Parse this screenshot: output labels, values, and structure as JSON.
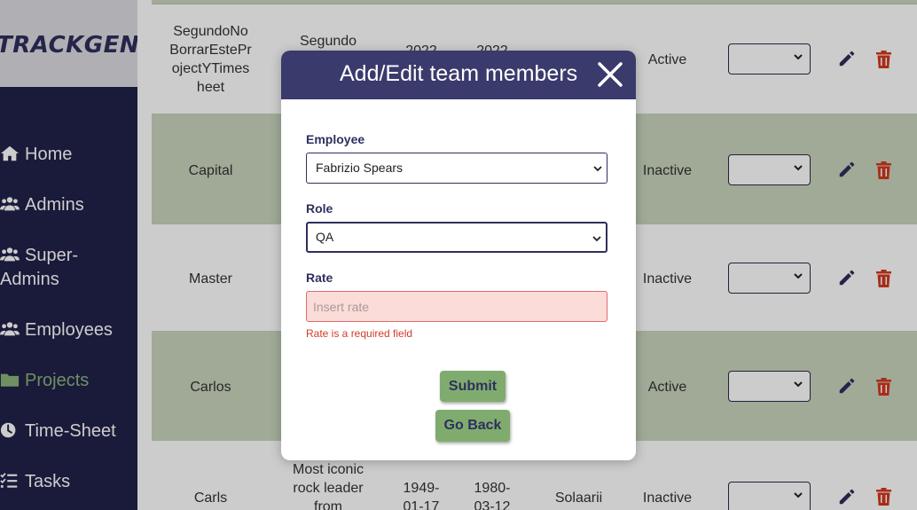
{
  "app": {
    "logo": "TRACKGENIX"
  },
  "sidebar": {
    "items": [
      {
        "label": "Home",
        "icon": "home-icon"
      },
      {
        "label": "Admins",
        "icon": "users-icon"
      },
      {
        "label": "Super-",
        "label2": "Admins",
        "icon": "users-icon"
      },
      {
        "label": "Employees",
        "icon": "users-icon"
      },
      {
        "label": "Projects",
        "icon": "folder-icon",
        "active": true
      },
      {
        "label": "Time-Sheet",
        "icon": "clock-icon"
      },
      {
        "label": "Tasks",
        "icon": "list-check-icon"
      }
    ],
    "active_color": "#8ab57a"
  },
  "table": {
    "rows": [
      {
        "name_lines": [
          "SegundoNo",
          "BorrarEstePr",
          "ojectYTimes",
          "heet"
        ],
        "desc": "Segundo",
        "start": "2022",
        "end": "2022",
        "status": "Active"
      },
      {
        "name": "Capital",
        "status": "Inactive"
      },
      {
        "name": "Master",
        "status": "Inactive"
      },
      {
        "name": "Carlos",
        "status": "Active"
      },
      {
        "name": "Carls",
        "desc_lines": [
          "Most iconic",
          "rock leader",
          "from"
        ],
        "start_lines": [
          "1949-",
          "01-17"
        ],
        "end_lines": [
          "1980-",
          "03-12"
        ],
        "client": "Solaarii",
        "status": "Inactive"
      }
    ]
  },
  "modal": {
    "title": "Add/Edit team members",
    "employee_label": "Employee",
    "employee_value": "Fabrizio Spears",
    "role_label": "Role",
    "role_value": "QA",
    "rate_label": "Rate",
    "rate_placeholder": "Insert rate",
    "rate_error": "Rate is a required field",
    "submit_label": "Submit",
    "back_label": "Go Back"
  },
  "colors": {
    "sidebar_bg": "#21214a",
    "header_bg": "#3a3a6c",
    "button_bg": "#7fac6e",
    "row_green": "#c9d5bd",
    "error": "#d23a2a",
    "delete_icon": "#d2391f"
  }
}
